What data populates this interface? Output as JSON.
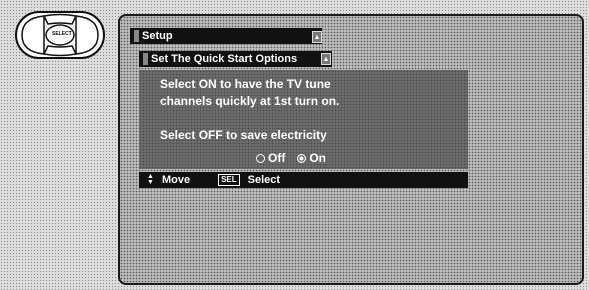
{
  "remote": {
    "button_label": "SELECT"
  },
  "menu": {
    "title": "Setup",
    "subtitle": "Set The Quick Start Options",
    "body_line1": "Select ON to have the TV tune",
    "body_line2": "channels quickly at 1st turn on.",
    "body_line3": "Select OFF to save electricity",
    "options": [
      {
        "label": "Off",
        "selected": false
      },
      {
        "label": "On",
        "selected": true
      }
    ]
  },
  "help": {
    "move_label": "Move",
    "sel_key": "SEL",
    "select_label": "Select"
  }
}
